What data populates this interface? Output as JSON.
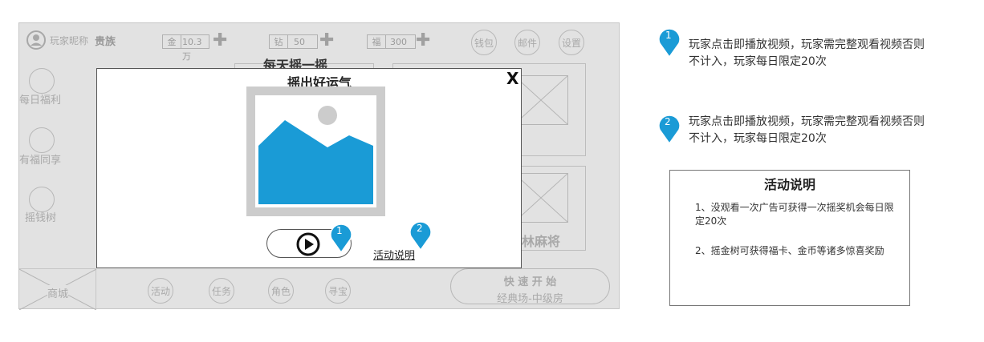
{
  "top_bar": {
    "avatar_icon": "user-avatar-icon",
    "nickname": "玩家昵称",
    "rank": "贵族",
    "gold": {
      "tag": "金",
      "value": "10.3万"
    },
    "diamond": {
      "tag": "钻",
      "value": "50"
    },
    "fortune": {
      "tag": "福",
      "value": "300"
    },
    "wallet": "钱包",
    "mail": "邮件",
    "settings": "设置"
  },
  "side_menu": [
    "每日福利",
    "有福同享",
    "摇钱树"
  ],
  "behind_title": "每天摇一摇",
  "card_label": "吉林麻将",
  "bottom_bar": {
    "shop": "商城",
    "activity": "活动",
    "task": "任务",
    "role": "角色",
    "treasure": "寻宝",
    "quick_start": "快 速 开 始",
    "room": "经典场-中级房"
  },
  "modal": {
    "title": "摇出好运气",
    "close": "X",
    "link": "活动说明",
    "play_icon": "play-icon"
  },
  "markers": [
    "1",
    "2"
  ],
  "notes": [
    "玩家点击即播放视频，玩家需完整观看视频否则不计入，玩家每日限定20次",
    "玩家点击即播放视频，玩家需完整观看视频否则不计入，玩家每日限定20次"
  ],
  "description": {
    "title": "活动说明",
    "item1": "1、没观看一次广告可获得一次摇奖机会每日限定20次",
    "item2": "2、摇金树可获得福卡、金币等诸多惊喜奖励"
  },
  "colors": {
    "marker": "#1a9bd6",
    "image": "#1a9bd6",
    "frame": "#e2e2e2"
  }
}
